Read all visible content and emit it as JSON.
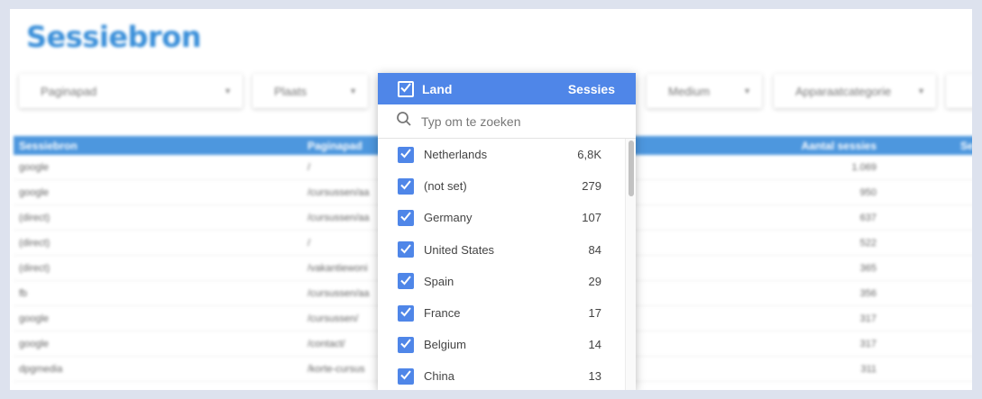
{
  "report": {
    "title": "Sessiebron",
    "filters": [
      {
        "label": "Paginapad"
      },
      {
        "label": "Plaats"
      },
      {
        "label": "Medium"
      },
      {
        "label": "Apparaatcategorie"
      }
    ],
    "table": {
      "columns": [
        "Sessiebron",
        "Paginapad",
        "Aantal sessies",
        "Se"
      ],
      "rows": [
        {
          "source": "google",
          "path": "/",
          "sessions": "1.069"
        },
        {
          "source": "google",
          "path": "/cursussen/aa",
          "sessions": "950"
        },
        {
          "source": "(direct)",
          "path": "/cursussen/aa",
          "sessions": "637"
        },
        {
          "source": "(direct)",
          "path": "/",
          "sessions": "522"
        },
        {
          "source": "(direct)",
          "path": "/vakantiewoni",
          "sessions": "365"
        },
        {
          "source": "fb",
          "path": "/cursussen/aa",
          "sessions": "356"
        },
        {
          "source": "google",
          "path": "/cursussen/",
          "sessions": "317"
        },
        {
          "source": "google",
          "path": "/contact/",
          "sessions": "317"
        },
        {
          "source": "dpgmedia",
          "path": "/korte-cursus",
          "sessions": "311"
        }
      ]
    }
  },
  "dropdown": {
    "header_label": "Land",
    "header_metric": "Sessies",
    "search_placeholder": "Typ om te zoeken",
    "items": [
      {
        "label": "Netherlands",
        "count": "6,8K"
      },
      {
        "label": "(not set)",
        "count": "279"
      },
      {
        "label": "Germany",
        "count": "107"
      },
      {
        "label": "United States",
        "count": "84"
      },
      {
        "label": "Spain",
        "count": "29"
      },
      {
        "label": "France",
        "count": "17"
      },
      {
        "label": "Belgium",
        "count": "14"
      },
      {
        "label": "China",
        "count": "13"
      }
    ]
  },
  "colors": {
    "accent": "#4f86e8",
    "title": "#3a8fd9",
    "table_header": "#4d97de",
    "backdrop": "#dde2ee"
  },
  "icons": {
    "search": "search-icon",
    "check": "check-icon",
    "caret": "caret-down-icon"
  }
}
